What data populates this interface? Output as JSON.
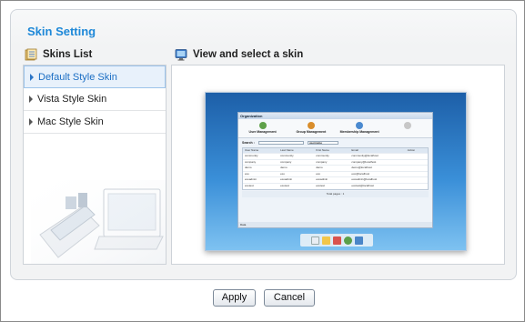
{
  "dialog": {
    "title": "Skin Setting"
  },
  "skins_list": {
    "heading": "Skins List",
    "items": [
      {
        "label": "Default Style Skin",
        "selected": true
      },
      {
        "label": "Vista Style Skin",
        "selected": false
      },
      {
        "label": "Mac Style Skin",
        "selected": false
      }
    ]
  },
  "preview": {
    "heading": "View and select a skin",
    "window_title": "Organization",
    "tabs": [
      "User Management",
      "Group Management",
      "Membership Management",
      ""
    ],
    "search_label": "Search :",
    "search_field": "username",
    "columns": [
      "User Name",
      "Last Name",
      "First Name",
      "Email",
      "Action"
    ],
    "rows": [
      [
        "community",
        "community",
        "community",
        "community@localhost",
        ""
      ],
      [
        "company",
        "company",
        "company",
        "company@localhost",
        ""
      ],
      [
        "demo",
        "demo",
        "demo",
        "demo@localhost",
        ""
      ],
      [
        "exo",
        "exo",
        "exo",
        "exo@localhost",
        ""
      ],
      [
        "exoadmin",
        "exoadmin",
        "exoadmin",
        "exoadmin@localhost",
        ""
      ],
      [
        "exotest",
        "exotest",
        "exotest",
        "exotest@localhost",
        ""
      ]
    ],
    "pager": "Total pages : 1",
    "status": "Data"
  },
  "buttons": {
    "apply": "Apply",
    "cancel": "Cancel"
  },
  "colors": {
    "title": "#1e88d8",
    "selected_item_bg": "#e8f1fb",
    "selected_item_text": "#1d6fc4",
    "preview_desktop": "#3a8fd8"
  }
}
